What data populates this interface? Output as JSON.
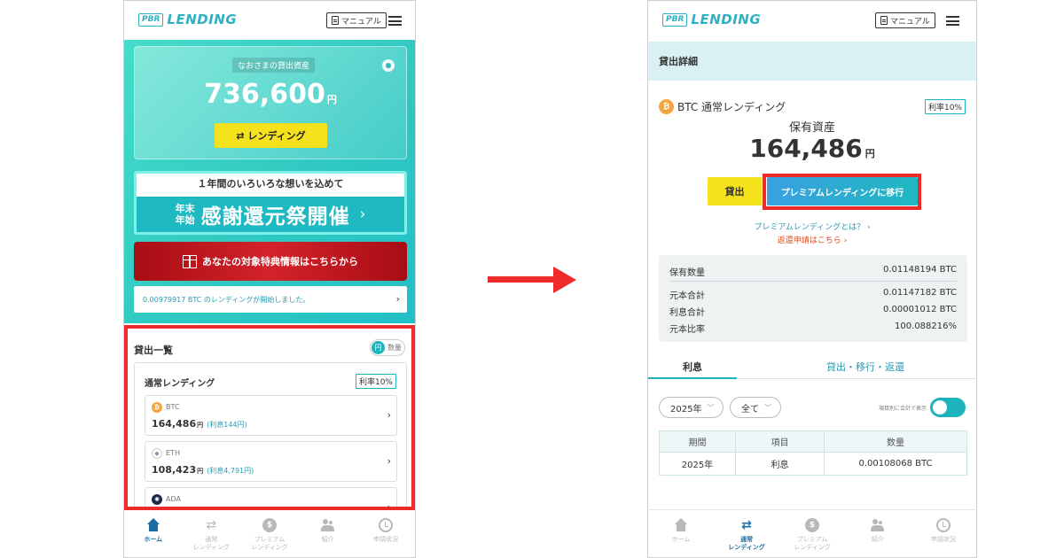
{
  "left": {
    "header": {
      "logo_box": "PBR",
      "logo_text": "LENDING",
      "manual": "マニュアル"
    },
    "asset": {
      "label": "なおさまの貸出資産",
      "amount": "736,600",
      "unit": "円",
      "lend_button": "⇄ レンディング"
    },
    "banner": {
      "top": "１年間のいろいろな想いを込めて",
      "small1": "年末",
      "small2": "年始",
      "big": "感謝還元祭開催",
      "chev": "›"
    },
    "red_banner": "あなたの対象特典情報はこちらから",
    "notice": "0.00979917 BTC のレンディングが開始しました。",
    "list": {
      "title": "貸出一覧",
      "toggle_knob": "円",
      "toggle_label": "数量",
      "card_title": "通常レンディング",
      "rate": "利率10%",
      "coins": [
        {
          "icon": "₿",
          "name": "BTC",
          "value": "164,486",
          "unit": "円",
          "interest": "(利息144円)",
          "color": "#f2a541"
        },
        {
          "icon": "◆",
          "name": "ETH",
          "value": "108,423",
          "unit": "円",
          "interest": "(利息4,791円)",
          "color": "#8a92b2"
        },
        {
          "icon": "✺",
          "name": "ADA",
          "value": "",
          "unit": "",
          "interest": "",
          "color": "#1b2a4a"
        }
      ]
    },
    "nav": [
      {
        "label": "ホーム",
        "label2": ""
      },
      {
        "label": "通常",
        "label2": "レンディング"
      },
      {
        "label": "プレミアム",
        "label2": "レンディング"
      },
      {
        "label": "紹介",
        "label2": ""
      },
      {
        "label": "申請状況",
        "label2": ""
      }
    ]
  },
  "right": {
    "header": {
      "logo_box": "PBR",
      "logo_text": "LENDING",
      "manual": "マニュアル"
    },
    "section_title": "貸出詳細",
    "product": {
      "icon": "₿",
      "title": "BTC 通常レンディング",
      "rate": "利率10%"
    },
    "hold_label": "保有資産",
    "hold_amount": "164,486",
    "hold_unit": "円",
    "btn_lend": "貸出",
    "btn_premium": "プレミアムレンディングに移行",
    "link_premium": "プレミアムレンディングとは？ ›",
    "link_return": "返還申請はこちら ›",
    "stats": [
      {
        "label": "保有数量",
        "value": "0.01148194 BTC"
      },
      {
        "label": "元本合計",
        "value": "0.01147182 BTC"
      },
      {
        "label": "利息合計",
        "value": "0.00001012 BTC"
      },
      {
        "label": "元本比率",
        "value": "100.088216%"
      }
    ],
    "tabs": {
      "active": "利息",
      "other": "貸出・移行・返還"
    },
    "filters": {
      "year": "2025年",
      "type": "全て",
      "switch_label": "項目別に合計で表示"
    },
    "table": {
      "headers": [
        "期間",
        "項目",
        "数量"
      ],
      "rows": [
        [
          "2025年",
          "利息",
          "0.00108068 BTC"
        ]
      ]
    },
    "nav": [
      {
        "label": "ホーム",
        "label2": ""
      },
      {
        "label": "通常",
        "label2": "レンディング"
      },
      {
        "label": "プレミアム",
        "label2": "レンディング"
      },
      {
        "label": "紹介",
        "label2": ""
      },
      {
        "label": "申請状況",
        "label2": ""
      }
    ]
  },
  "colors": {
    "accent": "#1eb3bd",
    "highlight": "#ee2b2b",
    "yellow": "#f5e21c"
  }
}
